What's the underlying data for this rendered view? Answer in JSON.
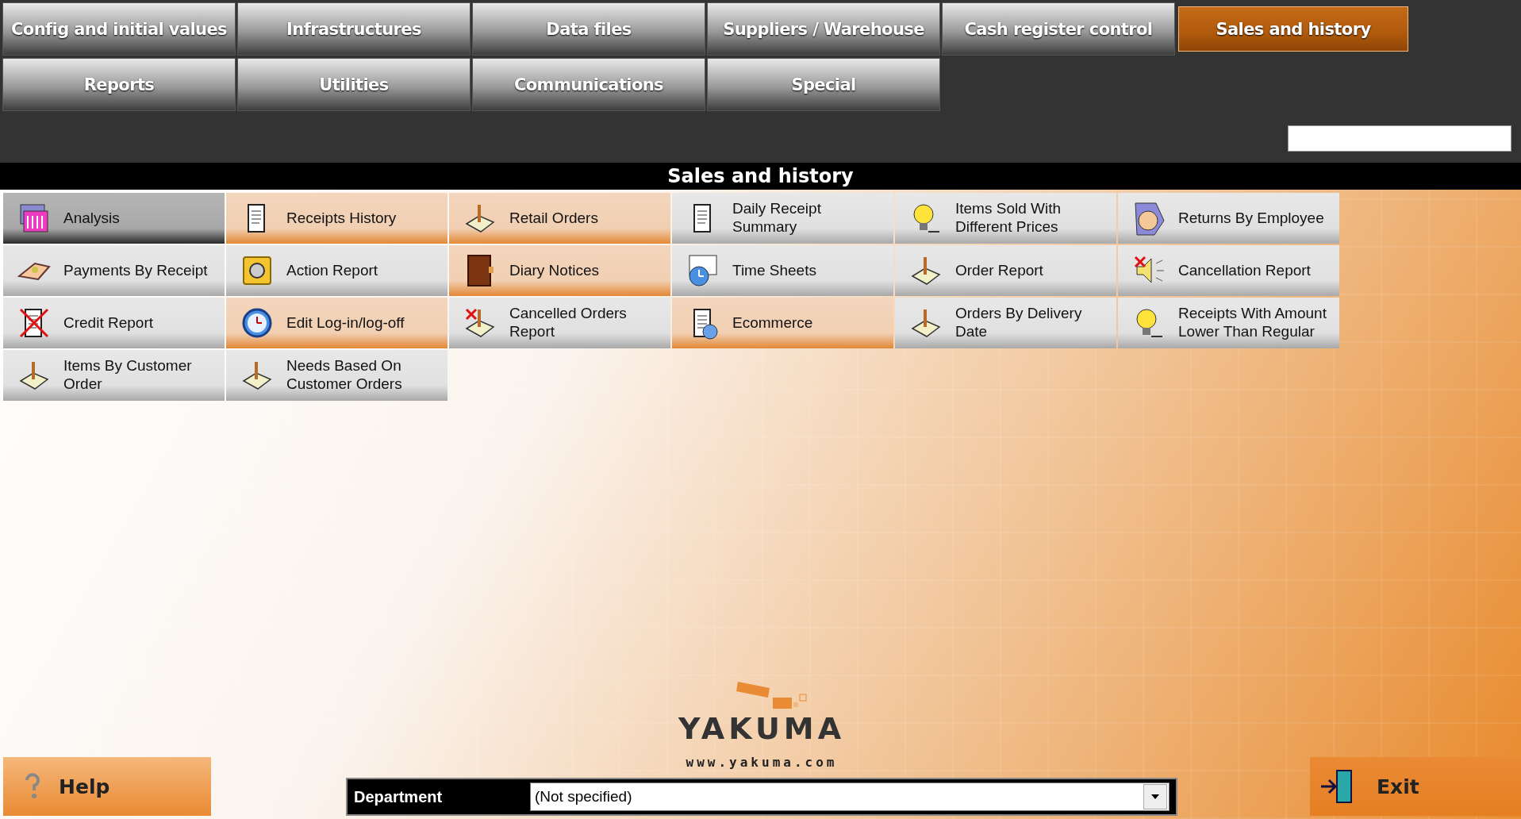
{
  "menu_tabs": [
    {
      "label": "Config and initial values",
      "selected": false
    },
    {
      "label": "Infrastructures",
      "selected": false
    },
    {
      "label": "Data files",
      "selected": false
    },
    {
      "label": "Suppliers / Warehouse",
      "selected": false
    },
    {
      "label": "Cash register control",
      "selected": false
    },
    {
      "label": "Sales and history",
      "selected": true
    },
    {
      "label": "Reports",
      "selected": false
    },
    {
      "label": "Utilities",
      "selected": false
    },
    {
      "label": "Communications",
      "selected": false
    },
    {
      "label": "Special",
      "selected": false
    }
  ],
  "section_title": "Sales and history",
  "items": [
    {
      "label": "Analysis",
      "selected": true,
      "highlighted": false
    },
    {
      "label": "Receipts History",
      "selected": false,
      "highlighted": true
    },
    {
      "label": "Retail Orders",
      "selected": false,
      "highlighted": true
    },
    {
      "label": "Daily Receipt Summary",
      "selected": false,
      "highlighted": false
    },
    {
      "label": "Items Sold With Different Prices",
      "selected": false,
      "highlighted": false
    },
    {
      "label": "Returns By Employee",
      "selected": false,
      "highlighted": false
    },
    {
      "label": "Payments By Receipt",
      "selected": false,
      "highlighted": false
    },
    {
      "label": "Action Report",
      "selected": false,
      "highlighted": false
    },
    {
      "label": "Diary Notices",
      "selected": false,
      "highlighted": true
    },
    {
      "label": "Time Sheets",
      "selected": false,
      "highlighted": false
    },
    {
      "label": "Order Report",
      "selected": false,
      "highlighted": false
    },
    {
      "label": "Cancellation Report",
      "selected": false,
      "highlighted": false
    },
    {
      "label": "Credit Report",
      "selected": false,
      "highlighted": false
    },
    {
      "label": "Edit Log-in/log-off",
      "selected": false,
      "highlighted": true
    },
    {
      "label": "Cancelled Orders Report",
      "selected": false,
      "highlighted": false
    },
    {
      "label": "Ecommerce",
      "selected": false,
      "highlighted": true
    },
    {
      "label": "Orders By Delivery Date",
      "selected": false,
      "highlighted": false
    },
    {
      "label": "Receipts With Amount Lower Than Regular",
      "selected": false,
      "highlighted": false
    },
    {
      "label": "Items By Customer Order",
      "selected": false,
      "highlighted": false
    },
    {
      "label": "Needs Based On Customer Orders",
      "selected": false,
      "highlighted": false
    }
  ],
  "logo": {
    "name": "YAKUMA",
    "url": "www.yakuma.com"
  },
  "help_button": "Help",
  "department": {
    "label": "Department",
    "value": "(Not specified)"
  },
  "exit_button": "Exit"
}
